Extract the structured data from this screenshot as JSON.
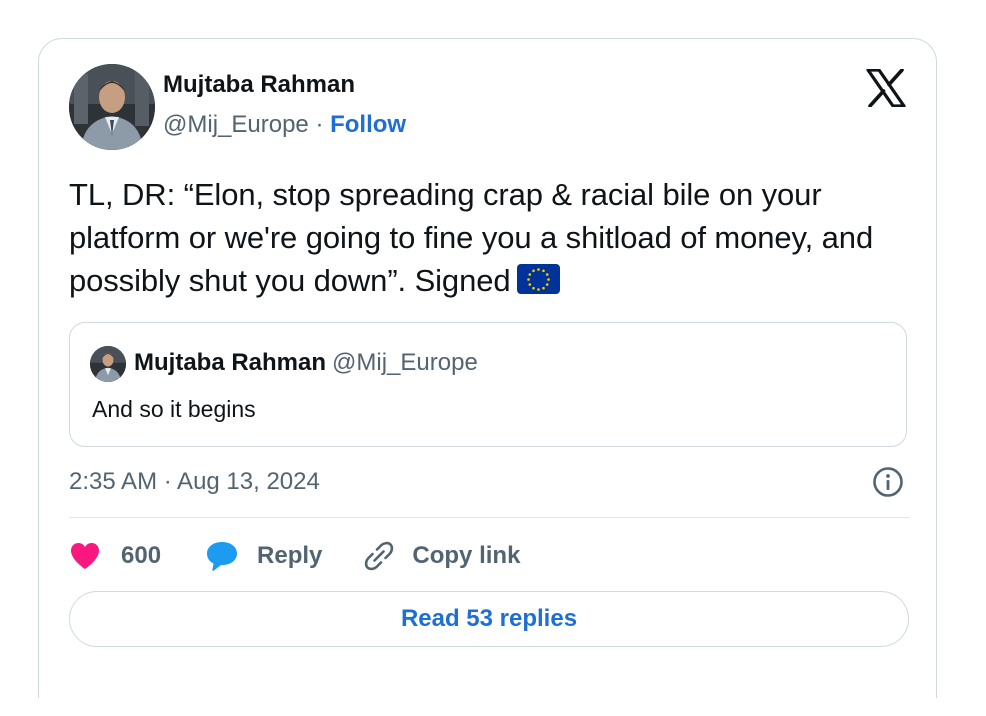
{
  "author": {
    "name": "Mujtaba Rahman",
    "handle": "@Mij_Europe",
    "separator": "·",
    "follow_label": "Follow"
  },
  "tweet": {
    "text": "TL, DR: “Elon, stop spreading crap & racial bile on your platform or we're going to fine you a shitload of money, and possibly shut you down”. Signed",
    "emoji": "eu-flag-emoji"
  },
  "quoted_tweet": {
    "name": "Mujtaba Rahman",
    "handle": "@Mij_Europe",
    "text": "And so it begins"
  },
  "timestamp": "2:35 AM · Aug 13, 2024",
  "actions": {
    "likes_count": "600",
    "reply_label": "Reply",
    "copy_link_label": "Copy link"
  },
  "read_replies_label": "Read 53 replies",
  "colors": {
    "link_blue": "#1d6fd6",
    "heart": "#f91880",
    "reply_bubble": "#1d9bf0",
    "text_primary": "#0f1419",
    "text_secondary": "#536471",
    "border": "#cfd9de",
    "eu_blue": "#003399",
    "eu_gold": "#ffcc00"
  },
  "icons": [
    "x-logo-icon",
    "info-icon",
    "heart-icon",
    "reply-bubble-icon",
    "link-icon",
    "eu-flag-emoji"
  ]
}
